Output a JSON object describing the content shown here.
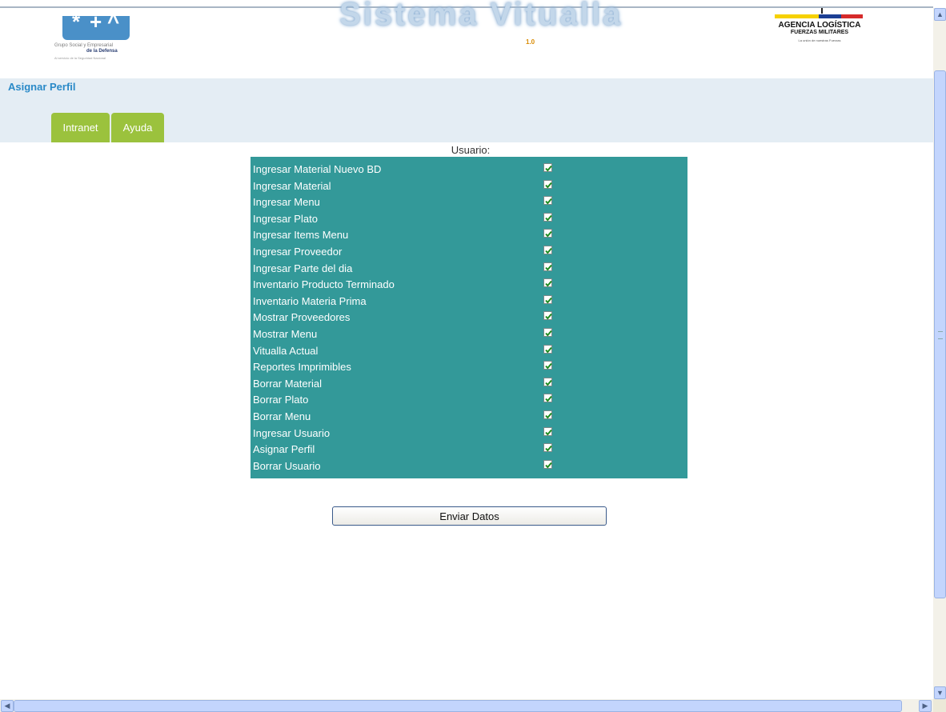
{
  "header": {
    "title": "Sistema Vitualla",
    "version": "1.0",
    "logo_left": {
      "line1": "Grupo Social y Empresarial",
      "line2": "de la Defensa",
      "line3": "Al servicio de la Seguridad Nacional"
    },
    "logo_right": {
      "line1": "AGENCIA LOGÍSTICA",
      "line2": "FUERZAS MILITARES",
      "line3": "La unión de nuestras Fuerzas"
    },
    "flag_colors": [
      "#f6d100",
      "#f6d100",
      "#1c3f94",
      "#d62b2b"
    ]
  },
  "page_heading": "Asignar Perfil",
  "tabs": [
    {
      "label": "Intranet"
    },
    {
      "label": "Ayuda"
    }
  ],
  "user_label": "Usuario:",
  "permissions": [
    {
      "label": "Ingresar Material Nuevo BD",
      "checked": true
    },
    {
      "label": "Ingresar Material",
      "checked": true
    },
    {
      "label": "Ingresar Menu",
      "checked": true
    },
    {
      "label": "Ingresar Plato",
      "checked": true
    },
    {
      "label": "Ingresar Items Menu",
      "checked": true
    },
    {
      "label": "Ingresar Proveedor",
      "checked": true
    },
    {
      "label": "Ingresar Parte del dia",
      "checked": true
    },
    {
      "label": "Inventario Producto Terminado",
      "checked": true
    },
    {
      "label": "Inventario Materia Prima",
      "checked": true
    },
    {
      "label": "Mostrar Proveedores",
      "checked": true
    },
    {
      "label": "Mostrar Menu",
      "checked": true
    },
    {
      "label": "Vitualla Actual",
      "checked": true
    },
    {
      "label": "Reportes Imprimibles",
      "checked": true
    },
    {
      "label": "Borrar Material",
      "checked": true
    },
    {
      "label": "Borrar Plato",
      "checked": true
    },
    {
      "label": "Borrar Menu",
      "checked": true
    },
    {
      "label": "Ingresar Usuario",
      "checked": true
    },
    {
      "label": "Asignar Perfil",
      "checked": true
    },
    {
      "label": "Borrar Usuario",
      "checked": true
    }
  ],
  "submit_label": "Enviar Datos",
  "colors": {
    "panel": "#339999",
    "tab": "#9bc23d",
    "band": "#e4edf4",
    "heading": "#2a8ac8",
    "check": "#1e8a1e"
  }
}
